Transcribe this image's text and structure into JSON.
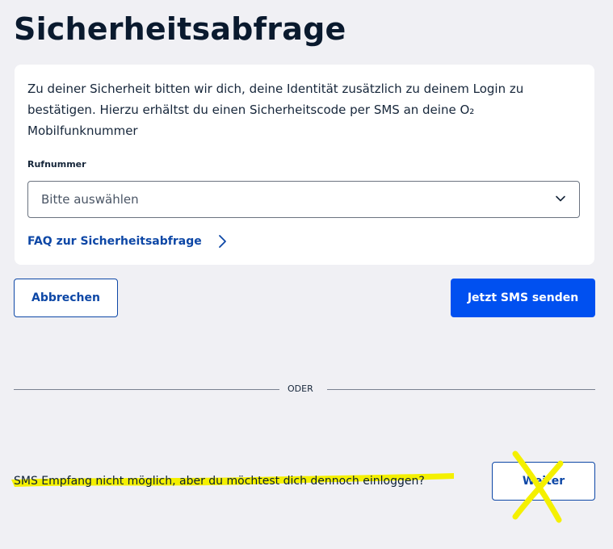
{
  "page": {
    "title": "Sicherheitsabfrage"
  },
  "card": {
    "intro_text": "Zu deiner Sicherheit bitten wir dich, deine Identität zusätzlich zu deinem Login zu bestätigen. Hierzu erhältst du einen Sicherheitscode per SMS an deine O₂ Mobilfunknummer",
    "phone_label": "Rufnummer",
    "phone_select": {
      "value": "Bitte auswählen",
      "icon": "chevron-down-icon"
    },
    "faq_link": {
      "label": "FAQ zur Sicherheitsabfrage",
      "icon": "chevron-right-icon"
    }
  },
  "actions": {
    "cancel_label": "Abbrechen",
    "send_label": "Jetzt SMS senden"
  },
  "divider": {
    "label": "ODER"
  },
  "alternative": {
    "text": "SMS Empfang nicht möglich, aber du möchtest dich dennoch einloggen?",
    "button_label": "Weiter"
  },
  "colors": {
    "background": "#f0f0f4",
    "primary": "#0050f0",
    "link": "#0d47a6",
    "highlight_annotation": "#f4f000"
  }
}
